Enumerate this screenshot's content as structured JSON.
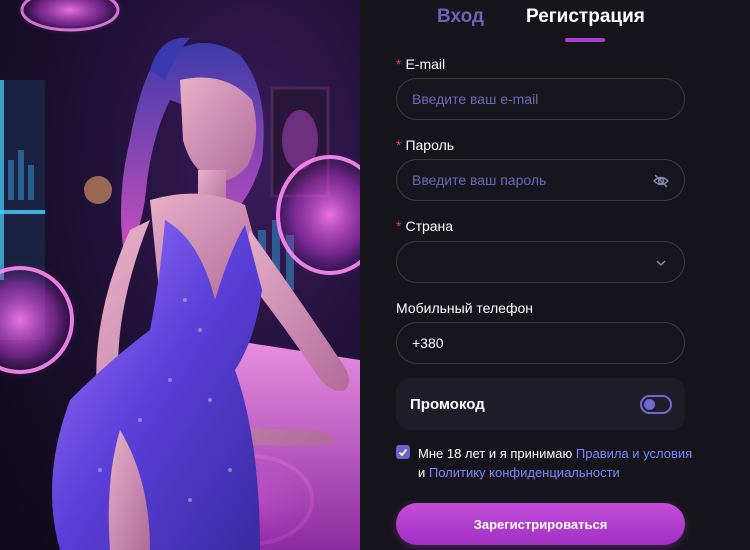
{
  "tabs": {
    "login": "Вход",
    "register": "Регистрация",
    "active": "register"
  },
  "form": {
    "email": {
      "label": "E-mail",
      "required": "*",
      "placeholder": "Введите ваш e-mail",
      "value": ""
    },
    "password": {
      "label": "Пароль",
      "required": "*",
      "placeholder": "Введите ваш пароль",
      "value": "",
      "icon": "eye-off-icon"
    },
    "country": {
      "label": "Страна",
      "required": "*",
      "value": "",
      "icon": "chevron-down-icon"
    },
    "phone": {
      "label": "Мобильный телефон",
      "value": "+380"
    },
    "promo": {
      "label": "Промокод",
      "enabled": false
    },
    "agree": {
      "checked": true,
      "text_before": "Мне 18 лет и я принимаю ",
      "rules_link": "Правила и условия",
      "and": " и ",
      "privacy_link": "Политику конфиденциальности"
    },
    "submit_label": "Зарегистрироваться"
  },
  "colors": {
    "accent": "#b13bd6",
    "link": "#7d86ff",
    "placeholder": "#6f69b5",
    "background": "#16151c"
  }
}
